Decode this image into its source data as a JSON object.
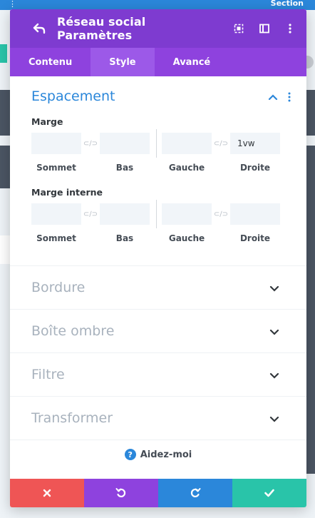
{
  "background": {
    "section_label": "Section"
  },
  "header": {
    "title": "Réseau social Paramètres",
    "icons": [
      "back-icon",
      "expand-icon",
      "sidebar-icon",
      "more-icon"
    ]
  },
  "tabs": [
    {
      "label": "Contenu",
      "active": false
    },
    {
      "label": "Style",
      "active": true
    },
    {
      "label": "Avancé",
      "active": false
    }
  ],
  "spacing": {
    "title": "Espacement",
    "margin": {
      "label": "Marge",
      "top": "",
      "bottom": "",
      "left": "",
      "right": "1vw"
    },
    "padding": {
      "label": "Marge interne",
      "top": "",
      "bottom": "",
      "left": "",
      "right": ""
    },
    "sub_labels": {
      "top": "Sommet",
      "bottom": "Bas",
      "left": "Gauche",
      "right": "Droite"
    }
  },
  "sections": [
    {
      "label": "Bordure"
    },
    {
      "label": "Boîte ombre"
    },
    {
      "label": "Filtre"
    },
    {
      "label": "Transformer"
    }
  ],
  "help": {
    "label": "Aidez-moi"
  },
  "footer": {
    "buttons": [
      "cancel-icon",
      "undo-icon",
      "redo-icon",
      "check-icon"
    ]
  },
  "colors": {
    "header": "#7e3bd0",
    "tabs": "#8e42de",
    "tab_active": "#9c59e8",
    "accent_blue": "#2b87da",
    "cancel": "#ef5555",
    "save": "#29c4a9"
  }
}
